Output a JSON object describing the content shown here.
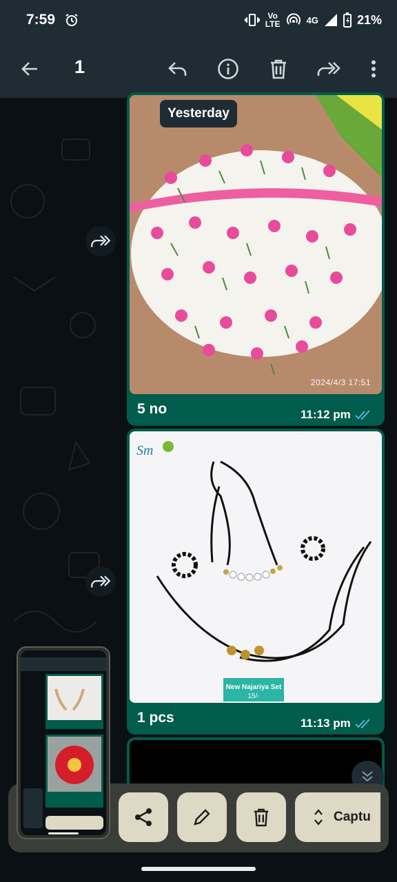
{
  "status_bar": {
    "time": "7:59",
    "volte_label": "Vo LTE",
    "network": "4G",
    "battery": "21%"
  },
  "top_bar": {
    "selected_count": "1"
  },
  "chat": {
    "date_chip": "Yesterday",
    "messages": [
      {
        "caption": "5 no",
        "time": "11:12 pm",
        "photo_stamp": "2024/4/3 17:51",
        "photo_desc": "pink floral dress"
      },
      {
        "caption": "1 pcs",
        "time": "11:13 pm",
        "photo_label": "New Najariya Set",
        "photo_price": "15/-"
      }
    ]
  },
  "screenshot_toolbar": {
    "capture_label": "Captu"
  },
  "colors": {
    "bubble": "#005c4b",
    "bar": "#1f2c34",
    "tick": "#53bdeb"
  }
}
